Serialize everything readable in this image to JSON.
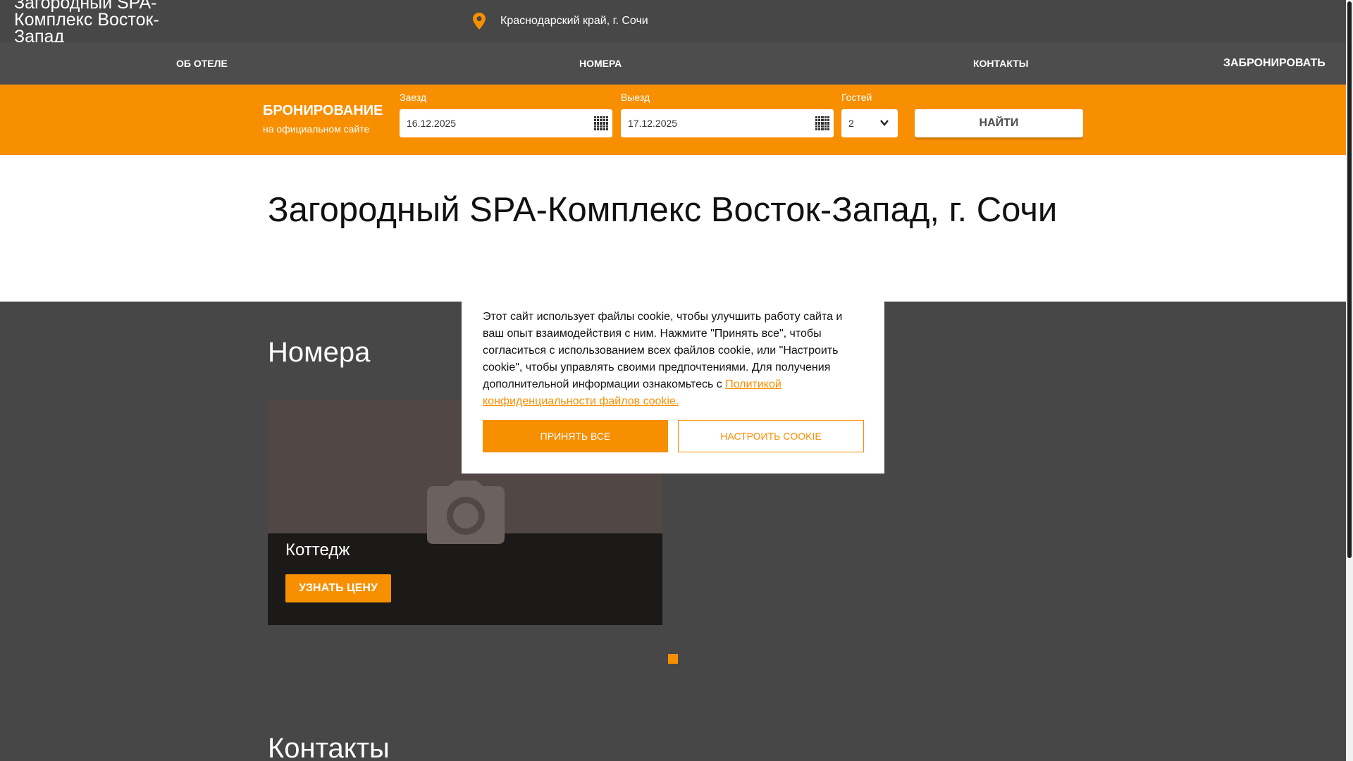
{
  "header": {
    "logo": "Загородный SPA-Комплекс Восток-Запад",
    "location": "Краснодарский край, г. Сочи",
    "location_icon": "map-pin-icon"
  },
  "nav": {
    "about": "ОБ ОТЕЛЕ",
    "rooms": "НОМЕРА",
    "contacts": "КОНТАКТЫ",
    "book": "ЗАБРОНИРОВАТЬ"
  },
  "booking": {
    "title": "БРОНИРОВАНИЕ",
    "subtitle": "на официальном сайте",
    "checkin_label": "Заезд",
    "checkin_value": "16.12.2025",
    "checkout_label": "Выезд",
    "checkout_value": "17.12.2025",
    "guests_label": "Гостей",
    "guests_value": "2",
    "find_label": "НАЙТИ"
  },
  "hero": {
    "title": "Загородный SPA-Комплекс Восток-Запад, г. Сочи"
  },
  "rooms": {
    "title": "Номера",
    "items": [
      {
        "name": "Коттедж",
        "button": "УЗНАТЬ ЦЕНУ"
      }
    ]
  },
  "contacts": {
    "title": "Контакты"
  },
  "cookie": {
    "text": "Этот сайт использует файлы cookie, чтобы улучшить работу сайта и ваш опыт взаимодействия с ним. Нажмите \"Принять все\", чтобы согласиться с использованием всех файлов cookie, или \"Настроить cookie\", чтобы управлять своими предпочтениями. Для получения дополнительной информации ознакомьтесь с ",
    "link": "Политикой конфиденциальности файлов cookie.",
    "accept": "ПРИНЯТЬ ВСЕ",
    "settings": "НАСТРОИТЬ COOKIE"
  },
  "colors": {
    "accent": "#f78f00",
    "dark_bg": "#474747",
    "card_bg": "#1c1a19"
  }
}
